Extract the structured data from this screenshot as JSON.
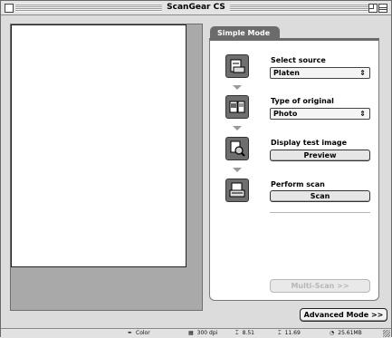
{
  "window": {
    "title": "ScanGear CS"
  },
  "tab": {
    "label": "Simple Mode"
  },
  "steps": [
    {
      "label": "Select source",
      "icon": "scanner-platen-icon",
      "control": "select",
      "value": "Platen"
    },
    {
      "label": "Type of original",
      "icon": "photo-original-icon",
      "control": "select",
      "value": "Photo"
    },
    {
      "label": "Display test image",
      "icon": "magnifier-preview-icon",
      "control": "button",
      "value": "Preview"
    },
    {
      "label": "Perform scan",
      "icon": "scan-document-icon",
      "control": "button",
      "value": "Scan"
    }
  ],
  "buttons": {
    "multiscan": "Multi-Scan >>",
    "advanced": "Advanced Mode >>"
  },
  "status": {
    "color": "Color",
    "resolution": "300 dpi",
    "width": "8.51",
    "height": "11.69",
    "size": "25.61MB"
  },
  "colors": {
    "panel_tab": "#6b6b6b",
    "preview_bg": "#a9a9a9",
    "window_bg": "#dcdcdc"
  }
}
